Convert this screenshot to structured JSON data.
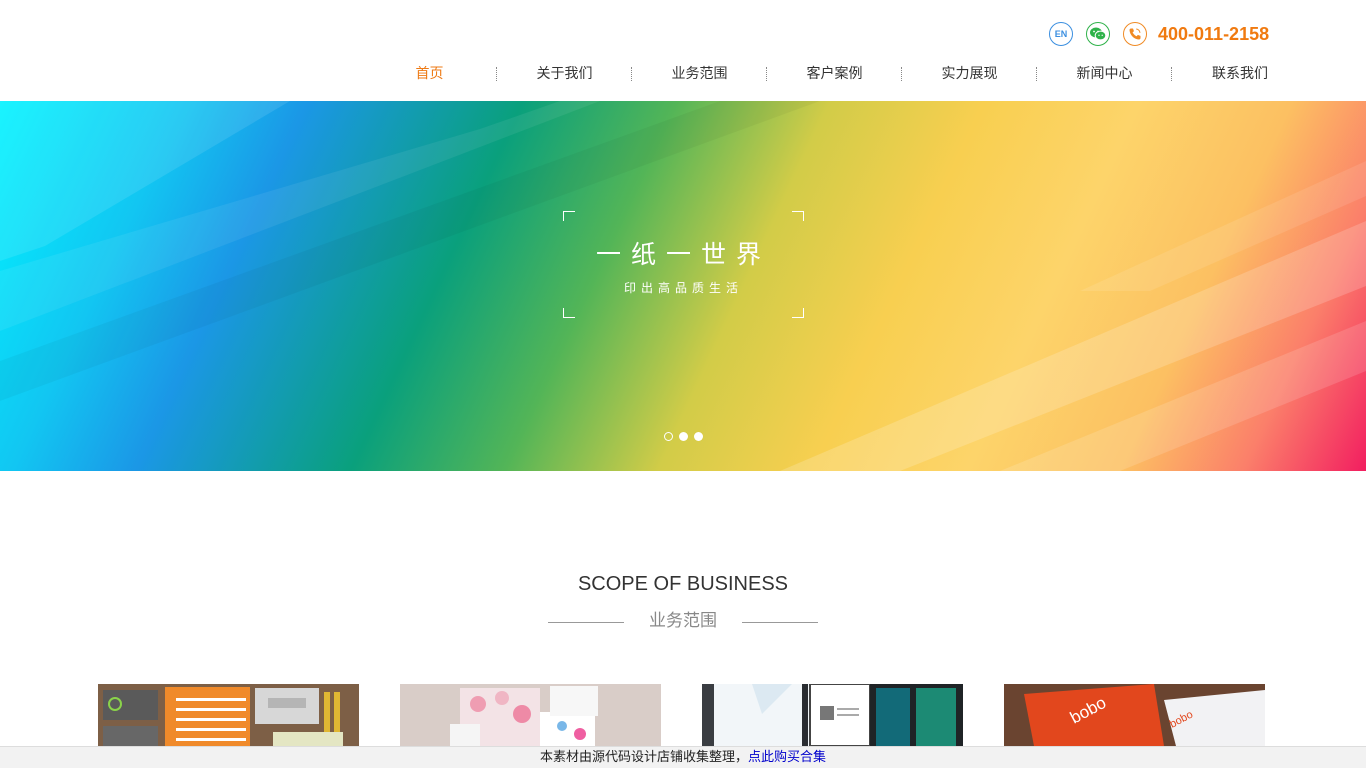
{
  "header": {
    "phone": "400-011-2158",
    "lang_badge": "EN",
    "icons": [
      "en-language-icon",
      "wechat-icon",
      "phone-icon"
    ],
    "nav": [
      {
        "label": "首页",
        "active": true
      },
      {
        "label": "关于我们",
        "active": false
      },
      {
        "label": "业务范围",
        "active": false
      },
      {
        "label": "客户案例",
        "active": false
      },
      {
        "label": "实力展现",
        "active": false
      },
      {
        "label": "新闻中心",
        "active": false
      },
      {
        "label": "联系我们",
        "active": false
      }
    ]
  },
  "banner": {
    "title": "一纸一世界",
    "subtitle": "印出高品质生活",
    "slide_count": 3,
    "active_slide": 1
  },
  "section": {
    "title": "SCOPE OF BUSINESS",
    "subtitle": "业务范围",
    "cards": [
      "notebook-stationery-image",
      "gift-box-image",
      "display-board-image",
      "business-card-image"
    ]
  },
  "notice": {
    "text": "本素材由源代码设计店铺收集整理，",
    "link": "点此购买合集"
  },
  "colors": {
    "accent": "#ee7a14",
    "phone": "#f07a10",
    "link": "#0000cc"
  }
}
